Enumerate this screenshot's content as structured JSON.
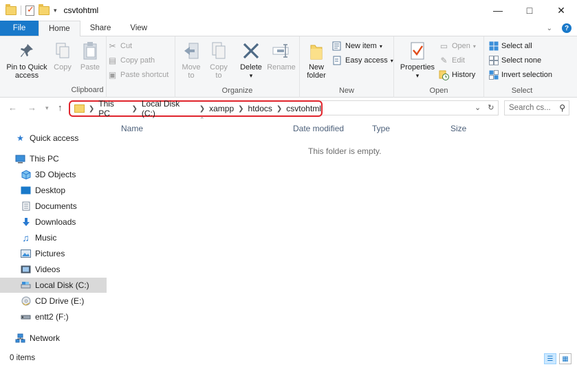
{
  "window": {
    "title": "csvtohtml"
  },
  "tabs": [
    {
      "label": "File"
    },
    {
      "label": "Home"
    },
    {
      "label": "Share"
    },
    {
      "label": "View"
    }
  ],
  "ribbon": {
    "clipboard": {
      "label": "Clipboard",
      "pin_line1": "Pin to Quick",
      "pin_line2": "access",
      "copy": "Copy",
      "paste": "Paste",
      "cut": "Cut",
      "copy_path": "Copy path",
      "paste_shortcut": "Paste shortcut"
    },
    "organize": {
      "label": "Organize",
      "move_to_1": "Move",
      "move_to_2": "to",
      "copy_to_1": "Copy",
      "copy_to_2": "to",
      "delete": "Delete",
      "rename": "Rename"
    },
    "new": {
      "label": "New",
      "new_folder_1": "New",
      "new_folder_2": "folder",
      "new_item": "New item",
      "easy_access": "Easy access"
    },
    "open": {
      "label": "Open",
      "properties": "Properties",
      "open": "Open",
      "edit": "Edit",
      "history": "History"
    },
    "select": {
      "label": "Select",
      "select_all": "Select all",
      "select_none": "Select none",
      "invert": "Invert selection"
    }
  },
  "address": {
    "crumbs": [
      "This PC",
      "Local Disk (C:)",
      "xampp",
      "htdocs",
      "csvtohtml"
    ]
  },
  "search": {
    "placeholder": "Search cs..."
  },
  "nav": {
    "quick_access": "Quick access",
    "this_pc": "This PC",
    "objects3d": "3D Objects",
    "desktop": "Desktop",
    "documents": "Documents",
    "downloads": "Downloads",
    "music": "Music",
    "pictures": "Pictures",
    "videos": "Videos",
    "local_disk": "Local Disk (C:)",
    "cd_drive": "CD Drive (E:)",
    "entt2": "entt2 (F:)",
    "network": "Network"
  },
  "columns": {
    "name": "Name",
    "date": "Date modified",
    "type": "Type",
    "size": "Size"
  },
  "empty_message": "This folder is empty.",
  "status": {
    "items": "0 items"
  },
  "colors": {
    "accent": "#1979ca",
    "highlight": "#e0242c",
    "folder": "#f6d46b"
  }
}
